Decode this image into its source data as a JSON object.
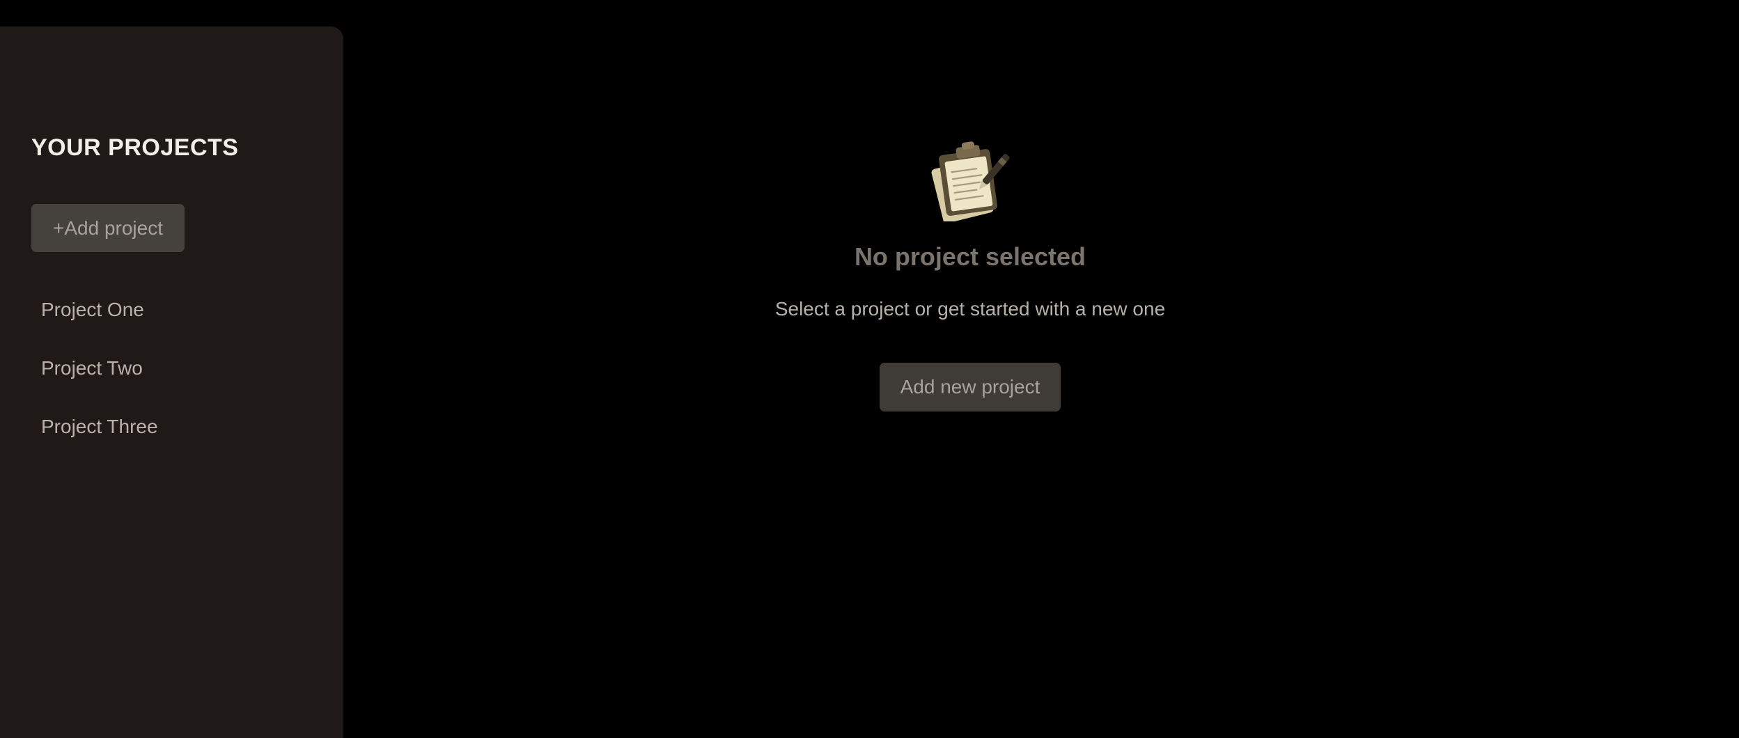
{
  "sidebar": {
    "title": "YOUR PROJECTS",
    "add_button_label": "+Add project",
    "projects": [
      {
        "label": "Project One"
      },
      {
        "label": "Project Two"
      },
      {
        "label": "Project Three"
      }
    ]
  },
  "main": {
    "icon": "clipboard-pen-icon",
    "empty_title": "No project selected",
    "empty_subtitle": "Select a project or get started with a new one",
    "add_new_button_label": "Add new project"
  },
  "colors": {
    "background": "#000000",
    "sidebar": "#1f1a17",
    "button": "#45413d",
    "title_text": "#f2efe9",
    "muted_text": "#7a746d"
  }
}
